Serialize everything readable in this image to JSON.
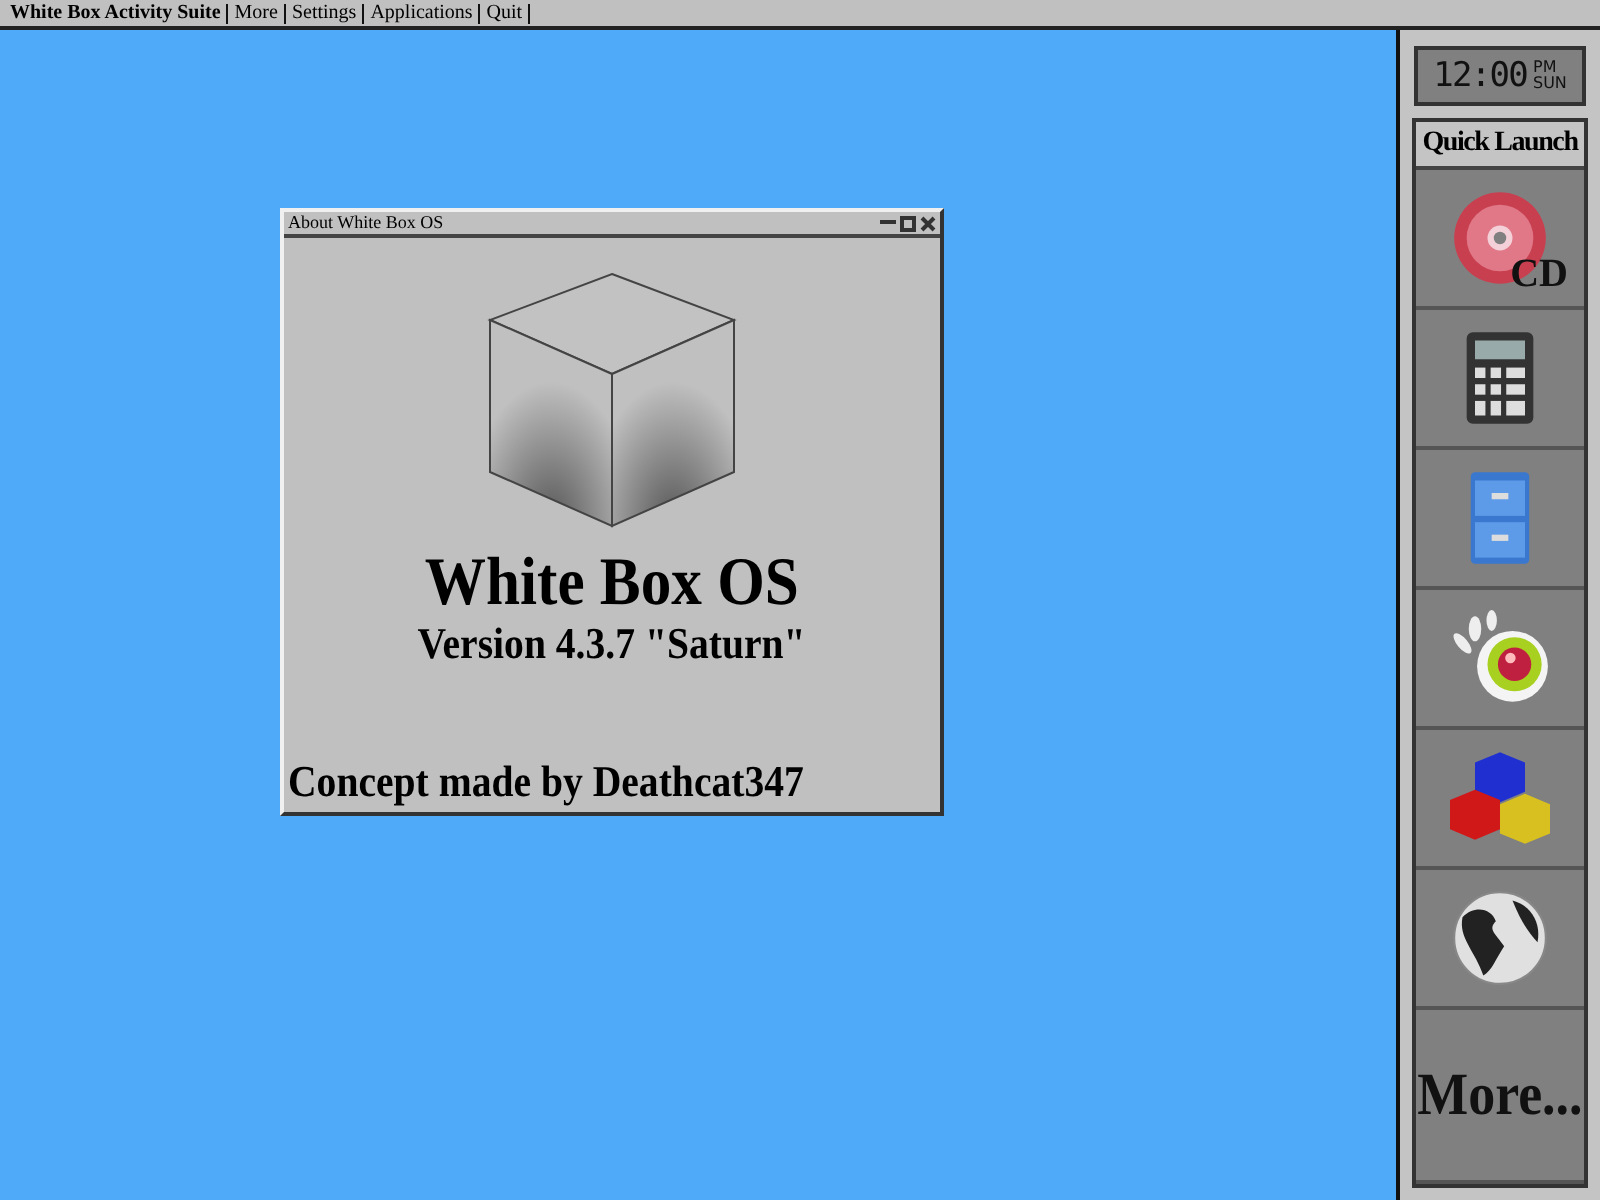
{
  "menu_bar": {
    "items": [
      "White Box Activity Suite",
      "More",
      "Settings",
      "Applications",
      "Quit"
    ]
  },
  "clock": {
    "time": "12:00",
    "meridiem": "PM",
    "day": "SUN"
  },
  "quick_launch": {
    "title": "Quick Launch",
    "items": [
      {
        "kind": "cd",
        "label": "CD"
      },
      {
        "kind": "calculator"
      },
      {
        "kind": "cabinet"
      },
      {
        "kind": "eye"
      },
      {
        "kind": "cubes"
      },
      {
        "kind": "globe"
      },
      {
        "kind": "text",
        "label": "More..."
      }
    ]
  },
  "about_window": {
    "title": "About White Box OS",
    "product": "White Box OS",
    "version": "Version 4.3.7 \"Saturn\"",
    "credit": "Concept made by Deathcat347"
  }
}
